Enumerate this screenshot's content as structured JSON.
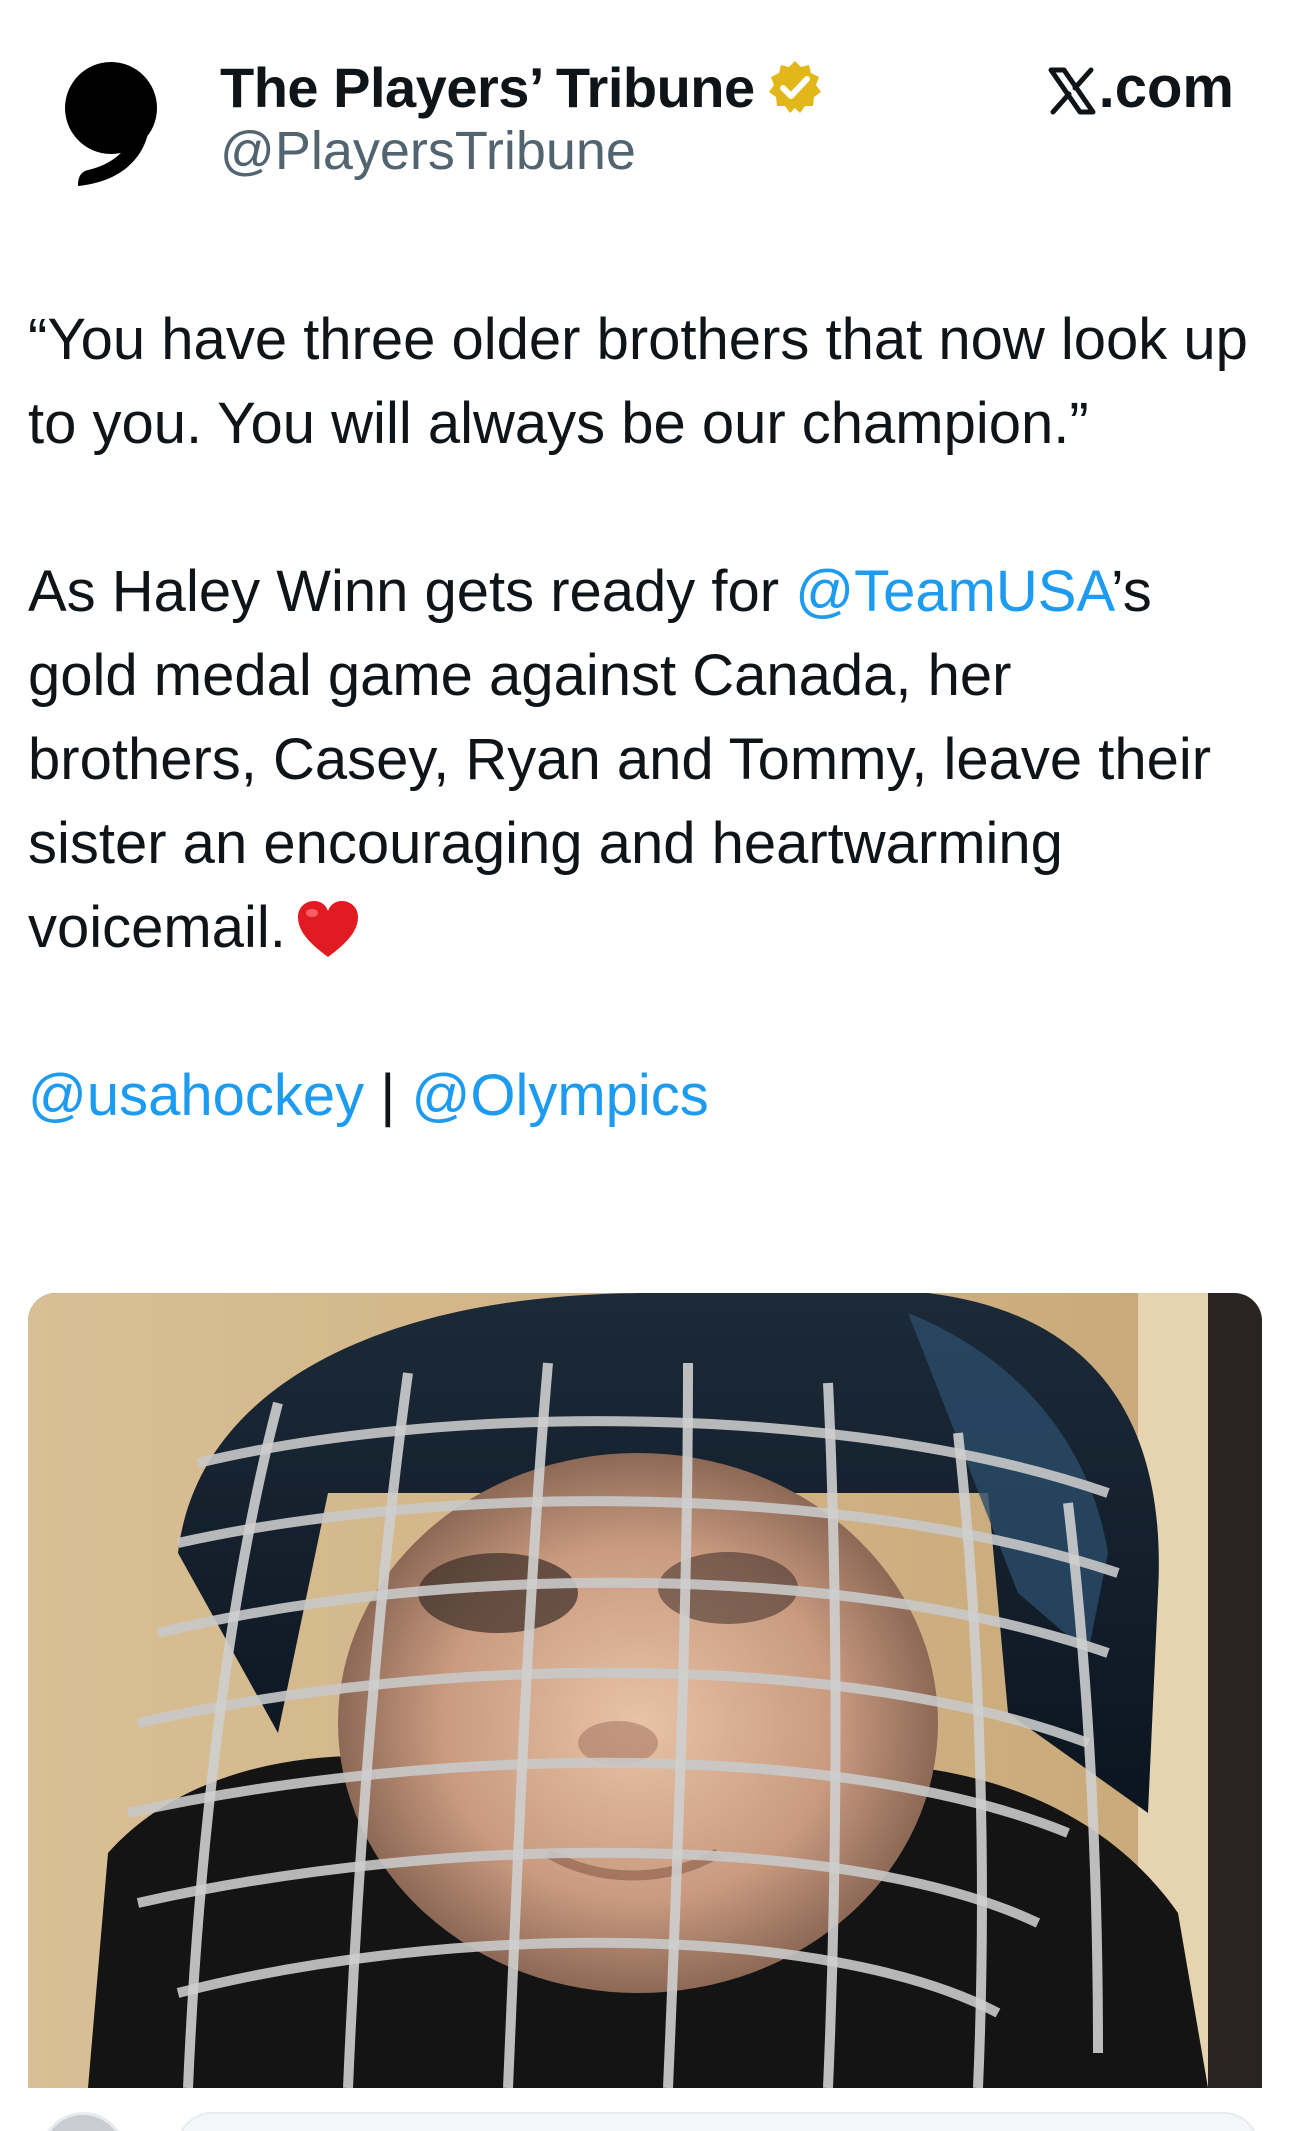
{
  "header": {
    "account_name": "The Players’ Tribune",
    "account_handle": "@PlayersTribune",
    "source_domain": ".com",
    "icons": {
      "avatar": "quote-comma-logo",
      "verified": "gold-verified-badge",
      "source": "x-logo"
    }
  },
  "tweet": {
    "paragraph_1": "“You have three older brothers that now look up to you. You will always be our champion.”",
    "paragraph_2_pre": "As Haley Winn gets ready for ",
    "paragraph_2_mention": "@TeamUSA",
    "paragraph_2_post": "’s gold medal game against Canada, her brothers, Casey, Ryan and Tommy, leave their sister an encouraging and heartwarming voicemail.",
    "mention_1": "@usahockey",
    "separator": " | ",
    "mention_2": "@Olympics"
  },
  "colors": {
    "text": "#0f1419",
    "handle": "#536471",
    "link": "#1d9bf0",
    "verified_badge": "#e2b719"
  },
  "media": {
    "type": "video-thumbnail",
    "subject": "child-in-hockey-helmet-with-cage"
  }
}
